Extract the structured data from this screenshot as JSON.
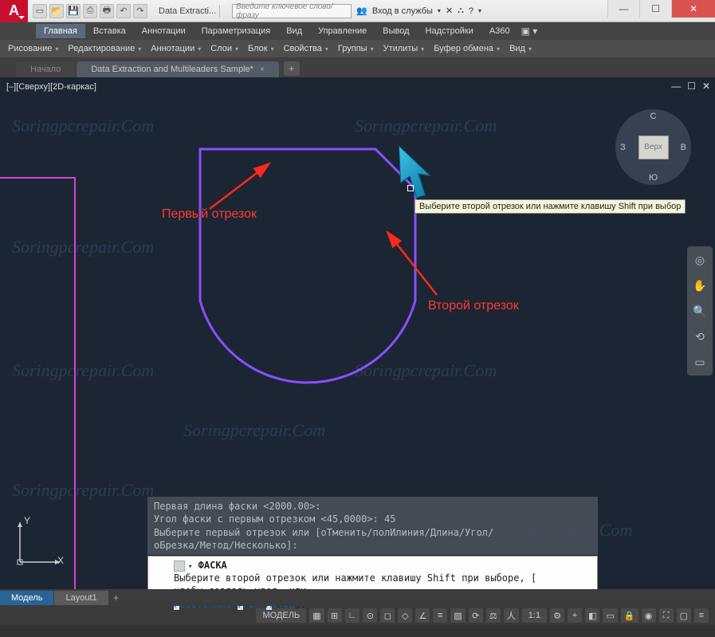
{
  "app": {
    "logo_letter": "A",
    "title_doc": "Data Extracti...",
    "search_placeholder": "Введите ключевое слово/фразу",
    "signin": "Вход в службы",
    "win_min": "—",
    "win_max": "☐",
    "win_close": "✕"
  },
  "menubar": [
    "Главная",
    "Вставка",
    "Аннотации",
    "Параметризация",
    "Вид",
    "Управление",
    "Вывод",
    "Надстройки",
    "A360"
  ],
  "ribbon_panels": [
    "Рисование",
    "Редактирование",
    "Аннотации",
    "Слои",
    "Блок",
    "Свойства",
    "Группы",
    "Утилиты",
    "Буфер обмена",
    "Вид"
  ],
  "tabs": {
    "start": "Начало",
    "active": "Data Extraction and Multileaders Sample*",
    "new": "+"
  },
  "viewport": {
    "label": "[–][Сверху][2D-каркас]",
    "min": "—",
    "max": "☐",
    "close": "✕"
  },
  "viewcube": {
    "face": "Верх",
    "n": "С",
    "s": "Ю",
    "e": "В",
    "w": "З"
  },
  "annotations": {
    "first": "Первый отрезок",
    "second": "Второй отрезок",
    "tooltip": "Выберите второй отрезок или нажмите клавишу Shift при выбор"
  },
  "cmd_history": {
    "l1": "Первая длина фаски <2000.00>:",
    "l2": "Угол фаски с первым отрезком <45,0000>: 45",
    "l3": "Выберите первый отрезок или [оТменить/полИлиния/Длина/Угол/",
    "l4": "оБрезка/Метод/Несколько]:"
  },
  "cmd_line": {
    "name": "ФАСКА",
    "prompt1": "Выберите второй отрезок или нажмите клавишу Shift при выборе,",
    "prompt2": "чтобы создать угол, или",
    "opts_pre": "[",
    "opt1": "Расстояние",
    "opt2": "Угол",
    "opt3": "Метод",
    "opts_post": "]:"
  },
  "layout_tabs": {
    "model": "Модель",
    "layout1": "Layout1",
    "add": "+"
  },
  "statusbar": {
    "model": "МОДЕЛЬ",
    "scale": "1:1"
  },
  "ucs": {
    "x": "X",
    "y": "Y"
  },
  "watermark": "Soringpcrepair.Com"
}
